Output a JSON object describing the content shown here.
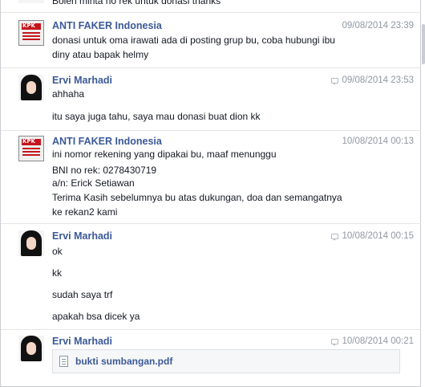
{
  "top_partial": {
    "text": "Boleh minta no rek untuk donasi  thanks"
  },
  "messages": [
    {
      "sender": "ANTI FAKER Indonesia",
      "avatar_icon": "kpk-logo-icon",
      "time": "09/08/2014 23:39",
      "lines": [
        "donasi untuk oma irawati ada di posting grup bu, coba hubungi ibu",
        "diny atau bapak helmy"
      ]
    },
    {
      "sender": "Ervi Marhadi",
      "avatar_icon": "profile-photo-icon",
      "time": "09/08/2014 23:53",
      "lines": [
        "ahhaha",
        "itu saya juga tahu, saya mau donasi buat dion kk"
      ]
    },
    {
      "sender": "ANTI FAKER Indonesia",
      "avatar_icon": "kpk-logo-icon",
      "time": "10/08/2014 00:13",
      "lines": [
        "ini nomor rekening yang dipakai bu, maaf menunggu",
        "BNI no rek: 0278430719",
        "a/n: Erick Setiawan",
        "Terima Kasih sebelumnya bu atas dukungan, doa dan semangatnya",
        "ke rekan2 kami"
      ]
    },
    {
      "sender": "Ervi Marhadi",
      "avatar_icon": "profile-photo-icon",
      "time": "10/08/2014 00:15",
      "lines": [
        "ok",
        "kk",
        "sudah saya trf",
        "apakah bsa dicek ya"
      ]
    },
    {
      "sender": "Ervi Marhadi",
      "avatar_icon": "profile-photo-icon",
      "time": "10/08/2014 00:21",
      "attachment": {
        "name": "bukti sumbangan.pdf",
        "icon": "pdf-file-icon"
      }
    }
  ],
  "colors": {
    "sender": "#3b5998",
    "timestamp": "#9197a3",
    "text": "#141823",
    "divider": "#e5e5e5"
  }
}
